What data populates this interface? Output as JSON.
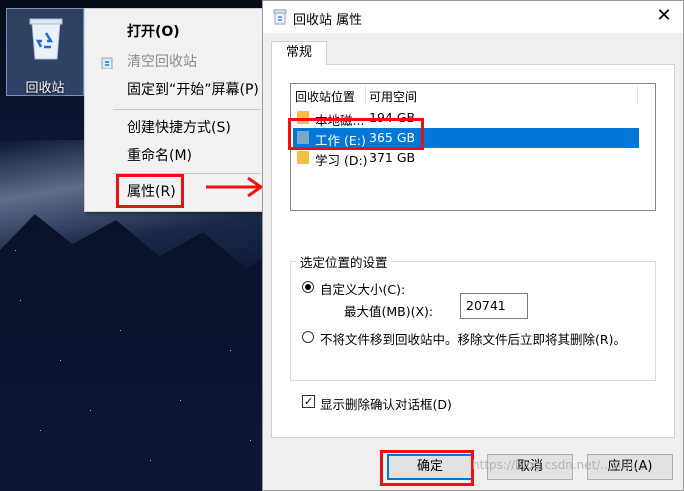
{
  "desktop": {
    "recycle_bin_label": "回收站"
  },
  "context_menu": {
    "items": [
      {
        "label": "打开(O)",
        "bold": true
      },
      {
        "label": "清空回收站",
        "disabled": true
      },
      {
        "label": "固定到“开始”屏幕(P)"
      },
      {
        "label": "创建快捷方式(S)"
      },
      {
        "label": "重命名(M)"
      },
      {
        "label": "属性(R)"
      }
    ]
  },
  "dialog": {
    "title": "回收站 属性",
    "close_symbol": "✕",
    "tab_label": "常规",
    "list": {
      "columns": [
        "回收站位置",
        "可用空间"
      ],
      "rows": [
        {
          "name": "本地磁...",
          "size": "194 GB",
          "icon": "folder-icon"
        },
        {
          "name": "工作 (E:)",
          "size": "365 GB",
          "icon": "drive-icon",
          "selected": true
        },
        {
          "name": "学习 (D:)",
          "size": "371 GB",
          "icon": "folder-icon"
        }
      ]
    },
    "group_title": "选定位置的设置",
    "custom_size_label": "自定义大小(C):",
    "max_size_label": "最大值(MB)(X):",
    "max_size_value": "20741",
    "no_move_label": "不将文件移到回收站中。移除文件后立即将其删除(R)。",
    "confirm_delete_label": "显示删除确认对话框(D)",
    "buttons": {
      "ok": "确定",
      "cancel": "取消",
      "apply": "应用(A)"
    }
  },
  "watermark": "https://blog.csdn.net/...sun...",
  "colors": {
    "selection": "#0078d7",
    "highlight_box": "#e11111"
  }
}
